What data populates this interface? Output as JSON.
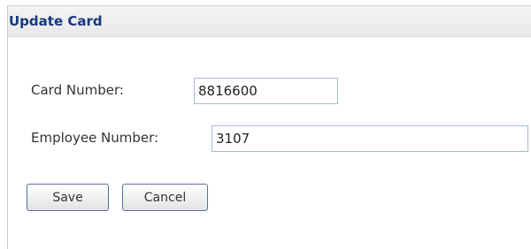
{
  "dialog": {
    "title": "Update Card"
  },
  "form": {
    "card_number_label": "Card Number:",
    "card_number_value": "8816600",
    "employee_number_label": "Employee Number:",
    "employee_number_value": "3107"
  },
  "buttons": {
    "save_label": "Save",
    "cancel_label": "Cancel"
  }
}
